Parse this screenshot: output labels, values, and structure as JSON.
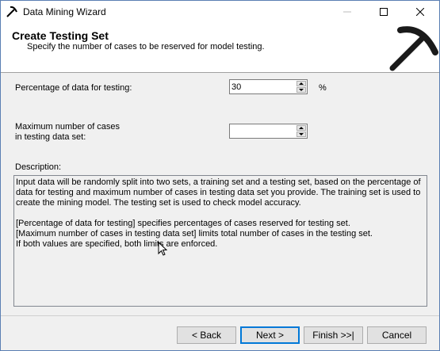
{
  "window": {
    "title": "Data Mining Wizard"
  },
  "header": {
    "title": "Create Testing Set",
    "subtitle": "Specify the number of cases to be reserved for model testing."
  },
  "form": {
    "percentage_label": "Percentage of data for testing:",
    "percentage_value": "30",
    "percentage_unit": "%",
    "max_cases_label_line1": "Maximum number of cases",
    "max_cases_label_line2": "in testing data set:",
    "max_cases_value": ""
  },
  "description": {
    "label": "Description:",
    "paragraph1": "Input data will be randomly split into two sets, a training set and a testing set, based on the percentage of data for testing and maximum number of cases in testing data set you provide. The training set is used to create the mining model. The testing set is used to check model accuracy.",
    "line2": "[Percentage of data for testing] specifies percentages of cases reserved for testing set.",
    "line3": "[Maximum number of cases in testing data set] limits total number of cases in the testing set.",
    "line4": "If both values are specified, both limits are enforced."
  },
  "buttons": {
    "back": "< Back",
    "next": "Next >",
    "finish": "Finish >>|",
    "cancel": "Cancel"
  },
  "icons": {
    "app": "pickaxe-icon",
    "header_logo": "pickaxe-icon",
    "minimize": "minimize-icon",
    "maximize": "maximize-icon",
    "close": "close-icon"
  }
}
